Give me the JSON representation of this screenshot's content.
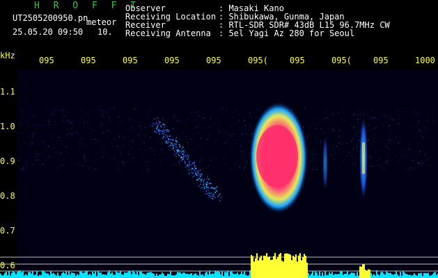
{
  "header": {
    "station": "H R O F F T",
    "filename": "UT2505200950.pn",
    "tag": "meteor",
    "date_time": "25.05.20 09:50",
    "period": "10."
  },
  "info": {
    "labels": [
      "Observer",
      "Receiving Location",
      "Receiver",
      "Receiving Antenna"
    ],
    "values": [
      ": Masaki Kano",
      ": Shibukawa, Gunma, Japan",
      ": RTL-SDR SDR# 43dB L15 96.7MHz CW",
      ": 5el Yagi Az 280 for Seoul"
    ]
  },
  "axes": {
    "unit": "kHz",
    "x_ticks": [
      "095",
      "095",
      "095",
      "095",
      "095",
      "095(",
      "095",
      "095(",
      "095",
      "1000"
    ],
    "y_ticks": [
      "1.1",
      "1.0",
      "0.9",
      "0.8",
      "0.7",
      "0.6"
    ]
  },
  "colors": {
    "background": "#000000",
    "label_yellow": "#ffff33",
    "title_green": "#2ecc40",
    "profile_cyan": "#00e5ff",
    "profile_yellow": "#ffff33",
    "echo_red": "#ff3366"
  }
}
